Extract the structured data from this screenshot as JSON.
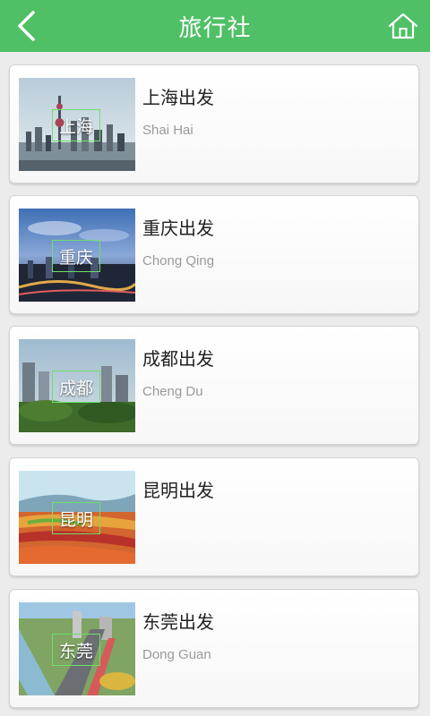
{
  "header": {
    "title": "旅行社",
    "back_icon": "chevron-left-icon",
    "home_icon": "home-icon",
    "bg_color": "#4fc065"
  },
  "items": [
    {
      "label": "上海",
      "title": "上海出发",
      "subtitle": "Shai Hai"
    },
    {
      "label": "重庆",
      "title": "重庆出发",
      "subtitle": "Chong Qing"
    },
    {
      "label": "成都",
      "title": "成都出发",
      "subtitle": "Cheng Du"
    },
    {
      "label": "昆明",
      "title": "昆明出发",
      "subtitle": ""
    },
    {
      "label": "东莞",
      "title": "东莞出发",
      "subtitle": "Dong Guan"
    }
  ]
}
